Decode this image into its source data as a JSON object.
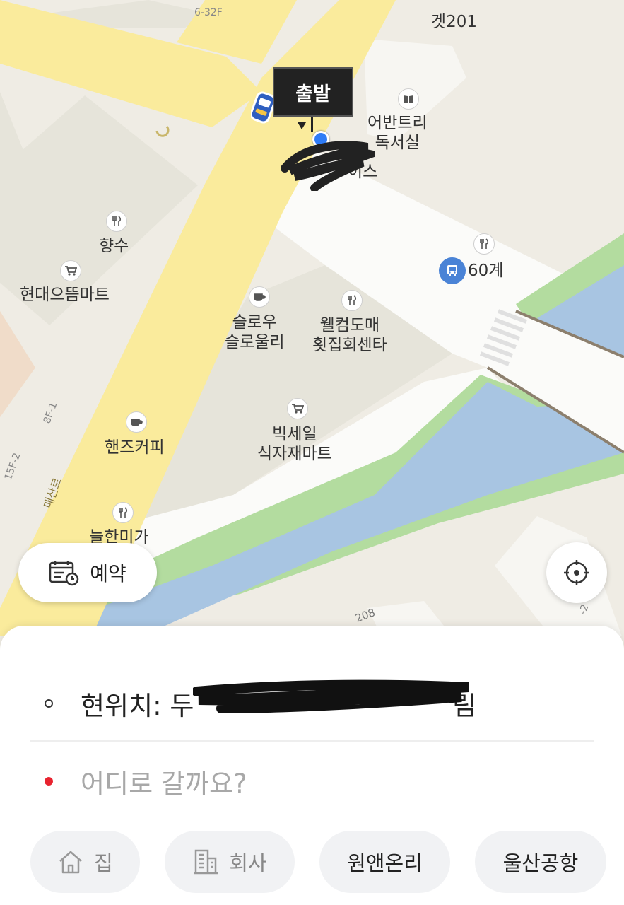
{
  "map": {
    "depart_label": "출발",
    "pois": [
      {
        "name": "겟201",
        "icon": "restaurant-icon"
      },
      {
        "name": "어반트리\n독서실",
        "icon": "book-icon"
      },
      {
        "name": "향수",
        "icon": "restaurant-icon"
      },
      {
        "name": "현대으뜸마트",
        "icon": "cart-icon"
      },
      {
        "name": "슬로우\n슬로울리",
        "icon": "coffee-icon"
      },
      {
        "name": "웰컴도매\n횟집회센타",
        "icon": "restaurant-icon"
      },
      {
        "name": "60계",
        "icon": "restaurant-icon"
      },
      {
        "name": "빅세일\n식자재마트",
        "icon": "cart-icon"
      },
      {
        "name": "핸즈커피",
        "icon": "coffee-icon"
      },
      {
        "name": "늘한미가",
        "icon": "restaurant-icon"
      },
      {
        "name": "이스",
        "icon": ""
      }
    ],
    "road_labels": [
      "매산로",
      "6-32F",
      "8F-1",
      "15F-2",
      "208",
      "-2"
    ],
    "colors": {
      "road": "#faeb9c",
      "water": "#a8c5e2",
      "park": "#b3dc9f",
      "block": "#e6e4da",
      "land": "#efece4"
    }
  },
  "buttons": {
    "reserve_label": "예약"
  },
  "search": {
    "origin_text": "현위치: 두",
    "origin_tail": "림",
    "destination_placeholder": "어디로 갈까요?"
  },
  "chips": [
    {
      "label": "집",
      "icon": "home-icon"
    },
    {
      "label": "회사",
      "icon": "building-icon"
    },
    {
      "label": "원앤온리",
      "icon": ""
    },
    {
      "label": "울산공항",
      "icon": ""
    }
  ]
}
